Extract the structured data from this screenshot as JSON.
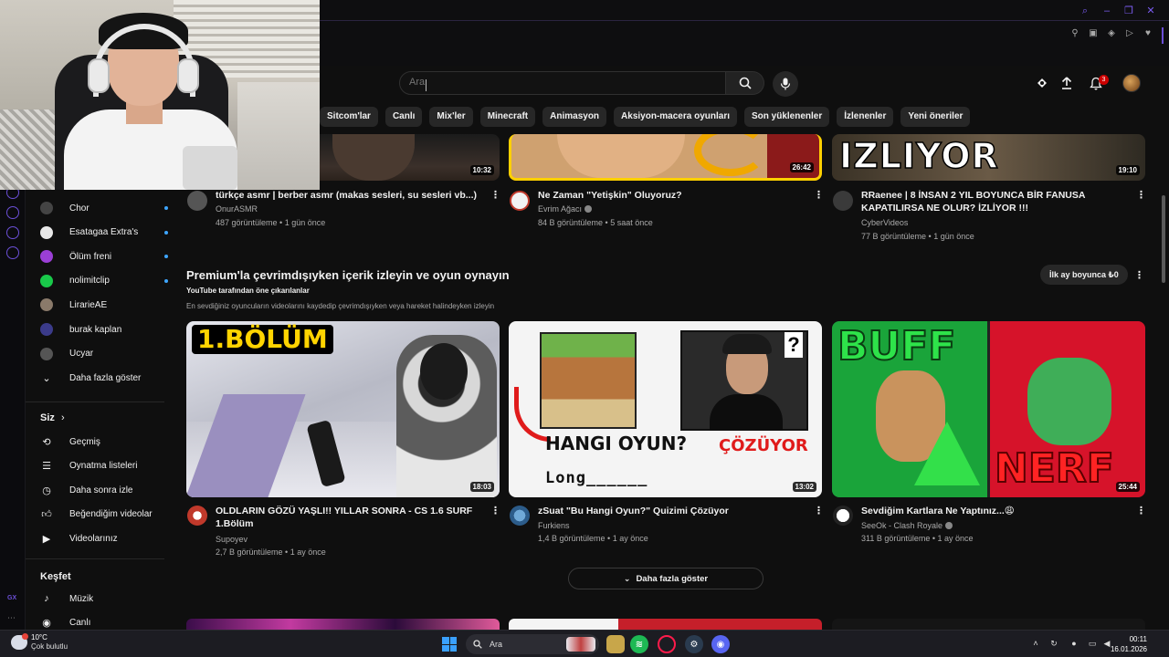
{
  "browser": {
    "window_controls": [
      "search-icon",
      "minimize-icon",
      "restore-icon",
      "close-icon"
    ],
    "extensions": [
      "pin-icon",
      "wallet-icon",
      "shield-icon",
      "play-icon",
      "heart-icon"
    ]
  },
  "header": {
    "search_placeholder": "Ara",
    "notification_count": "3",
    "icons": [
      "create-icon",
      "upload-icon",
      "bell-icon",
      "mic-icon",
      "search-icon"
    ]
  },
  "chips": [
    "Sitcom'lar",
    "Canlı",
    "Mix'ler",
    "Minecraft",
    "Animasyon",
    "Aksiyon-macera oyunları",
    "Son yüklenenler",
    "İzlenenler",
    "Yeni öneriler"
  ],
  "sidebar": {
    "subscriptions": [
      {
        "label": "Chor",
        "color": "#444444",
        "live": true
      },
      {
        "label": "Esatagaa Extra's",
        "color": "#e8e8e8",
        "live": true
      },
      {
        "label": "Ölüm freni",
        "color": "#9b3fd6",
        "live": true
      },
      {
        "label": "nolimitclip",
        "color": "#19c94a",
        "live": true
      },
      {
        "label": "LirarieAE",
        "color": "#8a7a6a",
        "live": false
      },
      {
        "label": "burak kaplan",
        "color": "#3b3b8a",
        "live": false
      },
      {
        "label": "Ucyar",
        "color": "#555555",
        "live": false
      }
    ],
    "show_more": "Daha fazla göster",
    "you_heading": "Siz",
    "you_items": [
      {
        "label": "Geçmiş",
        "icon": "history-icon"
      },
      {
        "label": "Oynatma listeleri",
        "icon": "playlist-icon"
      },
      {
        "label": "Daha sonra izle",
        "icon": "clock-icon"
      },
      {
        "label": "Beğendiğim videolar",
        "icon": "thumbs-up-icon"
      },
      {
        "label": "Videolarınız",
        "icon": "your-videos-icon"
      }
    ],
    "explore_heading": "Keşfet",
    "explore_items": [
      {
        "label": "Müzik",
        "icon": "music-icon"
      },
      {
        "label": "Canlı",
        "icon": "live-icon"
      }
    ]
  },
  "top_videos": [
    {
      "title": "türkçe asmr | berber asmr (makas sesleri, su sesleri vb...)",
      "channel": "OnurASMR",
      "meta": "487 görüntüleme • 1 gün önce",
      "duration": "10:32",
      "verified": false
    },
    {
      "title": "Ne Zaman \"Yetişkin\" Oluyoruz?",
      "channel": "Evrim Ağacı",
      "meta": "84 B görüntüleme • 5 saat önce",
      "duration": "26:42",
      "verified": true
    },
    {
      "title": "RRaenee | 8 İNSAN 2 YIL BOYUNCA BİR FANUSA KAPATILIRSA NE OLUR? İZLİYOR !!!",
      "channel": "CyberVideos",
      "meta": "77 B görüntüleme • 1 gün önce",
      "duration": "19:10",
      "verified": false,
      "thumb_text": "IZLIYOR"
    }
  ],
  "premium_shelf": {
    "title": "Premium'la çevrimdışıyken içerik izleyin ve oyun oynayın",
    "subtitle": "YouTube tarafından öne çıkarılanlar",
    "description": "En sevdiğiniz oyuncuların videolarını kaydedip çevrimdışıyken veya hareket halindeyken izleyin",
    "cta": "İlk ay boyunca ₺0",
    "show_more": "Daha fazla göster",
    "videos": [
      {
        "title": "OLDLARIN GÖZÜ YAŞLI!! YILLAR SONRA - CS 1.6 SURF 1.Bölüm",
        "channel": "Supoyev",
        "meta": "2,7 B görüntüleme • 1 ay önce",
        "duration": "18:03",
        "verified": false,
        "thumb_text": "1.BÖLÜM"
      },
      {
        "title": "zSuat \"Bu Hangi Oyun?\" Quizimi Çözüyor",
        "channel": "Furkiens",
        "meta": "1,4 B görüntüleme • 1 ay önce",
        "duration": "13:02",
        "verified": false,
        "thumb_text_1": "HANGI OYUN?",
        "thumb_text_2": "ÇÖZÜYOR",
        "thumb_text_3": "Long______"
      },
      {
        "title": "Sevdiğim Kartlara Ne Yaptınız...😩",
        "channel": "SeeOk - Clash Royale",
        "meta": "311 B görüntüleme • 1 ay önce",
        "duration": "25:44",
        "verified": true,
        "thumb_text_1": "BUFF",
        "thumb_text_2": "NERF"
      }
    ]
  },
  "taskbar": {
    "temp": "10°C",
    "condition": "Çok bulutlu",
    "search_label": "Ara",
    "time": "00:11",
    "date": "16.01.2026",
    "apps": [
      "file-explorer-icon",
      "spotify-icon",
      "opera-gx-icon",
      "steam-icon",
      "discord-icon"
    ]
  }
}
